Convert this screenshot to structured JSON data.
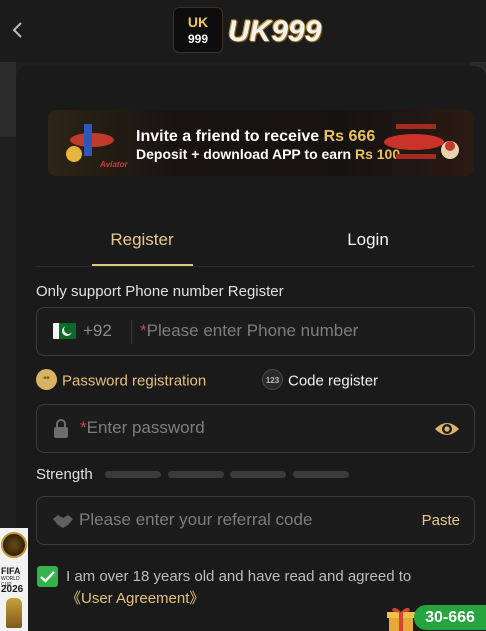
{
  "header": {
    "logo_badge_top": "UK",
    "logo_badge_bottom": "999",
    "logo_text": "UK999"
  },
  "banner": {
    "line1_prefix": "Invite a friend to receive ",
    "line1_amount": "Rs 666",
    "line2_prefix": "Deposit + download APP to earn ",
    "line2_amount": "Rs 100",
    "aviator_label": "Aviator"
  },
  "tabs": [
    {
      "label": "Register"
    },
    {
      "label": "Login"
    }
  ],
  "support_text": "Only support Phone number Register",
  "phone": {
    "country_code": "+92",
    "required_mark": "*",
    "placeholder": "Please enter Phone number"
  },
  "methods": {
    "password": {
      "icon_text": "**",
      "label": "Password registration"
    },
    "code": {
      "icon_text": "123",
      "label": "Code register"
    }
  },
  "password": {
    "required_mark": "*",
    "placeholder": "Enter password"
  },
  "strength_label": "Strength",
  "referral": {
    "placeholder": "Please enter your referral code",
    "paste_label": "Paste"
  },
  "agreement": {
    "text": "I am over 18 years old and have read and agreed to",
    "link": "《User Agreement》",
    "checked": true
  },
  "side_badge": {
    "line1": "FIFA",
    "line2": "WORLD CUP",
    "line3": "2026"
  },
  "promo": {
    "label": "30-666"
  },
  "colors": {
    "accent_gold": "#e6c17a",
    "check_green": "#35b34a",
    "promo_green": "#25a53e",
    "required_red": "#d34040"
  }
}
